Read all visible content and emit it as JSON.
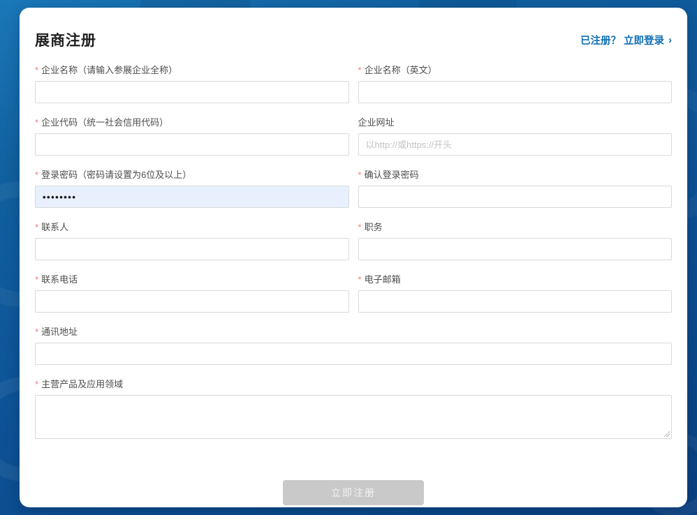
{
  "page": {
    "title": "展商注册",
    "login_prompt": "已注册？ 立即登录",
    "login_chevron": "›"
  },
  "form": {
    "required_marker": "*",
    "fields": {
      "company_name_cn": {
        "label": "企业名称（请输入参展企业全称）",
        "required": true,
        "value": "",
        "placeholder": ""
      },
      "company_name_en": {
        "label": "企业名称（英文）",
        "required": true,
        "value": "",
        "placeholder": ""
      },
      "company_code": {
        "label": "企业代码（统一社会信用代码）",
        "required": true,
        "value": "",
        "placeholder": ""
      },
      "website": {
        "label": "企业网址",
        "required": false,
        "value": "",
        "placeholder": "以http://或https://开头"
      },
      "password": {
        "label": "登录密码（密码请设置为6位及以上）",
        "required": true,
        "value": "••••••••",
        "placeholder": ""
      },
      "confirm_password": {
        "label": "确认登录密码",
        "required": true,
        "value": "",
        "placeholder": ""
      },
      "contact_person": {
        "label": "联系人",
        "required": true,
        "value": "",
        "placeholder": ""
      },
      "job_title": {
        "label": "职务",
        "required": true,
        "value": "",
        "placeholder": ""
      },
      "phone": {
        "label": "联系电话",
        "required": true,
        "value": "",
        "placeholder": ""
      },
      "email": {
        "label": "电子邮箱",
        "required": true,
        "value": "",
        "placeholder": ""
      },
      "address": {
        "label": "通讯地址",
        "required": true,
        "value": "",
        "placeholder": ""
      },
      "main_products": {
        "label": "主营产品及应用领域",
        "required": true,
        "value": "",
        "placeholder": ""
      }
    }
  },
  "submit": {
    "label": "立即注册"
  },
  "colors": {
    "background_blue": "#0d5296",
    "link_blue": "#0e6eb4",
    "required_red": "#f07c7c",
    "input_border": "#d9d9d9",
    "password_fill_bg": "#e8f0fe",
    "button_gray": "#c9c9c9"
  }
}
